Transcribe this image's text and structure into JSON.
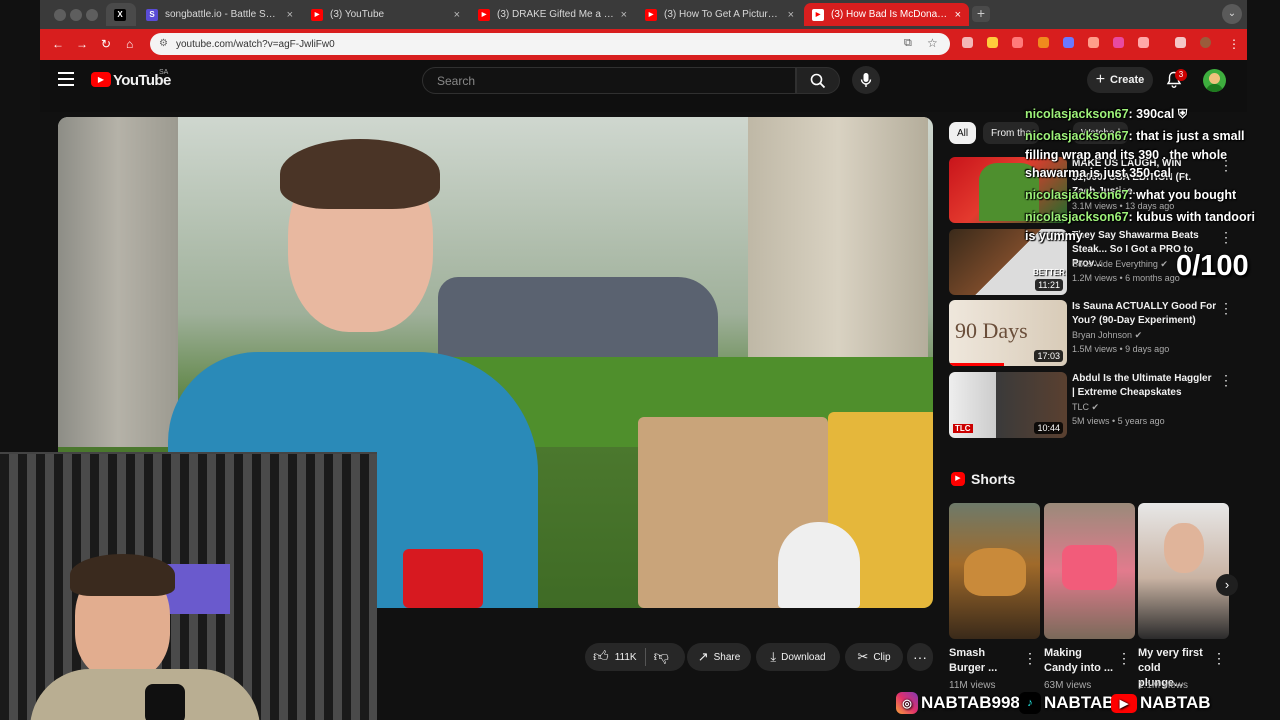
{
  "browser": {
    "tabs": [
      {
        "label": "",
        "favicon": "X"
      },
      {
        "label": "songbattle.io - Battle Songs",
        "favicon": "S"
      },
      {
        "label": "(3) YouTube",
        "favicon": "▶"
      },
      {
        "label": "(3) DRAKE Gifted Me a Car!",
        "favicon": "▶"
      },
      {
        "label": "(3) How To Get A Picture Wit",
        "favicon": "▶"
      },
      {
        "label": "(3) How Bad Is McDonald's R",
        "favicon": "▶"
      }
    ],
    "url": "youtube.com/watch?v=agF-JwliFw0",
    "theme_color": "#d81e1e"
  },
  "youtube": {
    "logo_text": "YouTube",
    "region": "SA",
    "search_placeholder": "Search",
    "create_label": "Create",
    "notification_count": "3"
  },
  "actions": {
    "likes": "111K",
    "share": "Share",
    "download": "Download",
    "clip": "Clip"
  },
  "chips": {
    "all": "All",
    "from_the": "From the",
    "watched": "Watched"
  },
  "recommendations": [
    {
      "title": "MAKE US LAUGH, WIN $1,000: USA EDITION (Ft. Zach Justice...",
      "channel": "",
      "views": "3.1M views • 13 days ago",
      "duration": ""
    },
    {
      "title": "They Say Shawarma Beats Steak... So I Got a PRO to Prov...",
      "channel": "Sous Vide Everything",
      "views": "1.2M views • 6 months ago",
      "duration": "11:21"
    },
    {
      "title": "Is Sauna ACTUALLY Good For You? (90-Day Experiment)",
      "channel": "Bryan Johnson",
      "views": "1.5M views • 9 days ago",
      "duration": "17:03"
    },
    {
      "title": "Abdul Is the Ultimate Haggler | Extreme Cheapskates",
      "channel": "TLC",
      "views": "5M views • 5 years ago",
      "duration": "10:44"
    }
  ],
  "thumb_text": {
    "better": "BETTER",
    "days": "90 Days",
    "tlc": "TLC"
  },
  "shorts": {
    "heading": "Shorts",
    "items": [
      {
        "title": "Smash Burger ...",
        "views": "11M views"
      },
      {
        "title": "Making Candy into ...",
        "views": "63M views"
      },
      {
        "title": "My very first cold plunge...",
        "views": "1.1M views"
      }
    ]
  },
  "chat": [
    {
      "user": "nicolasjackson67",
      "text": ": 390cal"
    },
    {
      "user": "nicolasjackson67",
      "text": ": that is just a small"
    },
    {
      "user": "",
      "text": "filling wrap and its 390 . the whole"
    },
    {
      "user": "",
      "text": "shawarma is just 350 cal"
    },
    {
      "user": "nicolasjackson67",
      "text": ": what you bought"
    },
    {
      "user": "nicolasjackson67",
      "text": ": kubus with tandoori"
    },
    {
      "user": "",
      "text": "is yummy"
    }
  ],
  "score_counter": "0/100",
  "socials": {
    "instagram": "NABTAB9988",
    "tiktok": "NABTAB",
    "youtube": "NABTAB"
  }
}
